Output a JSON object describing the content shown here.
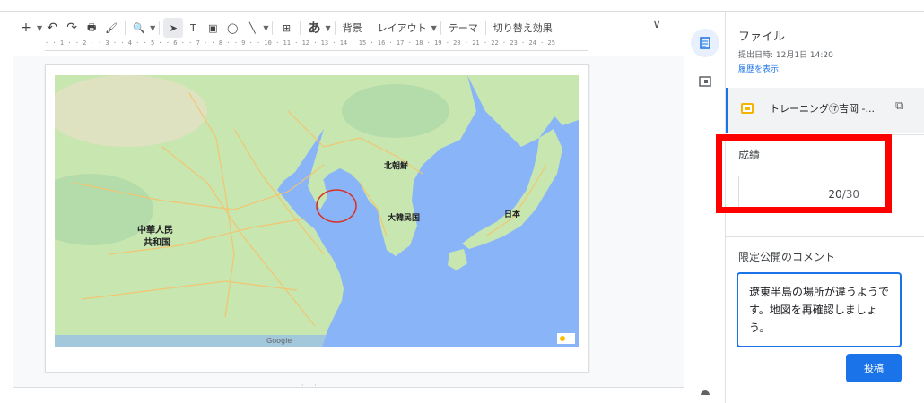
{
  "toolbar": {
    "add_icon": "+",
    "undo_icon": "↶",
    "redo_icon": "↷",
    "print_icon": "🖶",
    "paint_icon": "🖌",
    "zoom_icon": "🔍",
    "select_icon": "➤",
    "textbox_icon": "T",
    "image_icon": "▣",
    "shape_icon": "◯",
    "line_icon": "╲",
    "comment_icon": "⊞",
    "input_tools_label": "あ",
    "background_label": "背景",
    "layout_label": "レイアウト",
    "theme_label": "テーマ",
    "transition_label": "切り替え効果",
    "collapse_icon": "∨"
  },
  "ruler": {
    "marks": "· · 1 · · 2 · · 3 · · 4 · · 5 · · 6 · · 7 · · 8 · · 9 · · 10 · 11 · 12 · 13 · 14 · 15 · 16 · 17 · 18 · 19 · 20 · 21 · 22 · 23 · 24 · 25"
  },
  "map": {
    "labels": {
      "north_korea": "北朝鮮",
      "south_korea": "大韓民国",
      "japan": "日本",
      "china_line1": "中華人民",
      "china_line2": "共和国",
      "watermark": "Google"
    },
    "colors": {
      "sea": "#8ab4f8",
      "land": "#c8e6b0",
      "land_dark": "#a5d6a7",
      "roads": "#f6c26b",
      "circle": "#d93025"
    }
  },
  "panel": {
    "file_title": "ファイル",
    "submitted": "提出日時: 12月1日 14:20",
    "history_link": "履歴を表示",
    "file_name": "トレーニング⑰吉岡 -...",
    "open_icon": "⧉",
    "grade_label": "成績",
    "grade_value": "20",
    "grade_denominator": "/30",
    "kebab_icon": "⋮",
    "comment_label": "限定公開のコメント",
    "comment_text": "遼東半島の場所が違うようです。地図を再確認しましょう。",
    "post_button": "投稿"
  }
}
